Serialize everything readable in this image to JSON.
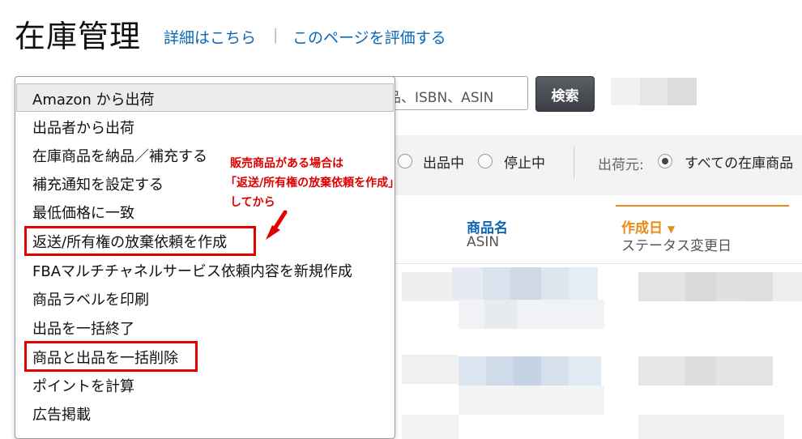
{
  "page": {
    "title": "在庫管理",
    "link_details": "詳細はこちら",
    "separator": "|",
    "link_rate": "このページを評価する"
  },
  "search": {
    "placeholder_visible": "品、ISBN、ASIN",
    "button_label": "検索"
  },
  "filters": {
    "option_active": "出品中",
    "option_stopped": "停止中",
    "ship_from_label": "出荷元:",
    "ship_from_value": "すべての在庫商品"
  },
  "table": {
    "col_product_name": "商品名",
    "col_asin": "ASIN",
    "col_created": "作成日",
    "col_status_changed": "ステータス変更日",
    "sort_arrow": "▼"
  },
  "dropdown": {
    "items": [
      "Amazon から出荷",
      "出品者から出荷",
      "在庫商品を納品／補充する",
      "補充通知を設定する",
      "最低価格に一致",
      "返送/所有権の放棄依頼を作成",
      "FBAマルチチャネルサービス依頼内容を新規作成",
      "商品ラベルを印刷",
      "出品を一括終了",
      "商品と出品を一括削除",
      "ポイントを計算",
      "広告掲載"
    ]
  },
  "annotation": {
    "line1": "販売商品がある場合は",
    "line2": "「返送/所有権の放棄依頼を作成」",
    "line3": "してから"
  },
  "colors": {
    "link": "#0a67b5",
    "highlight": "#e00000",
    "sort_accent": "#e88b1b"
  }
}
